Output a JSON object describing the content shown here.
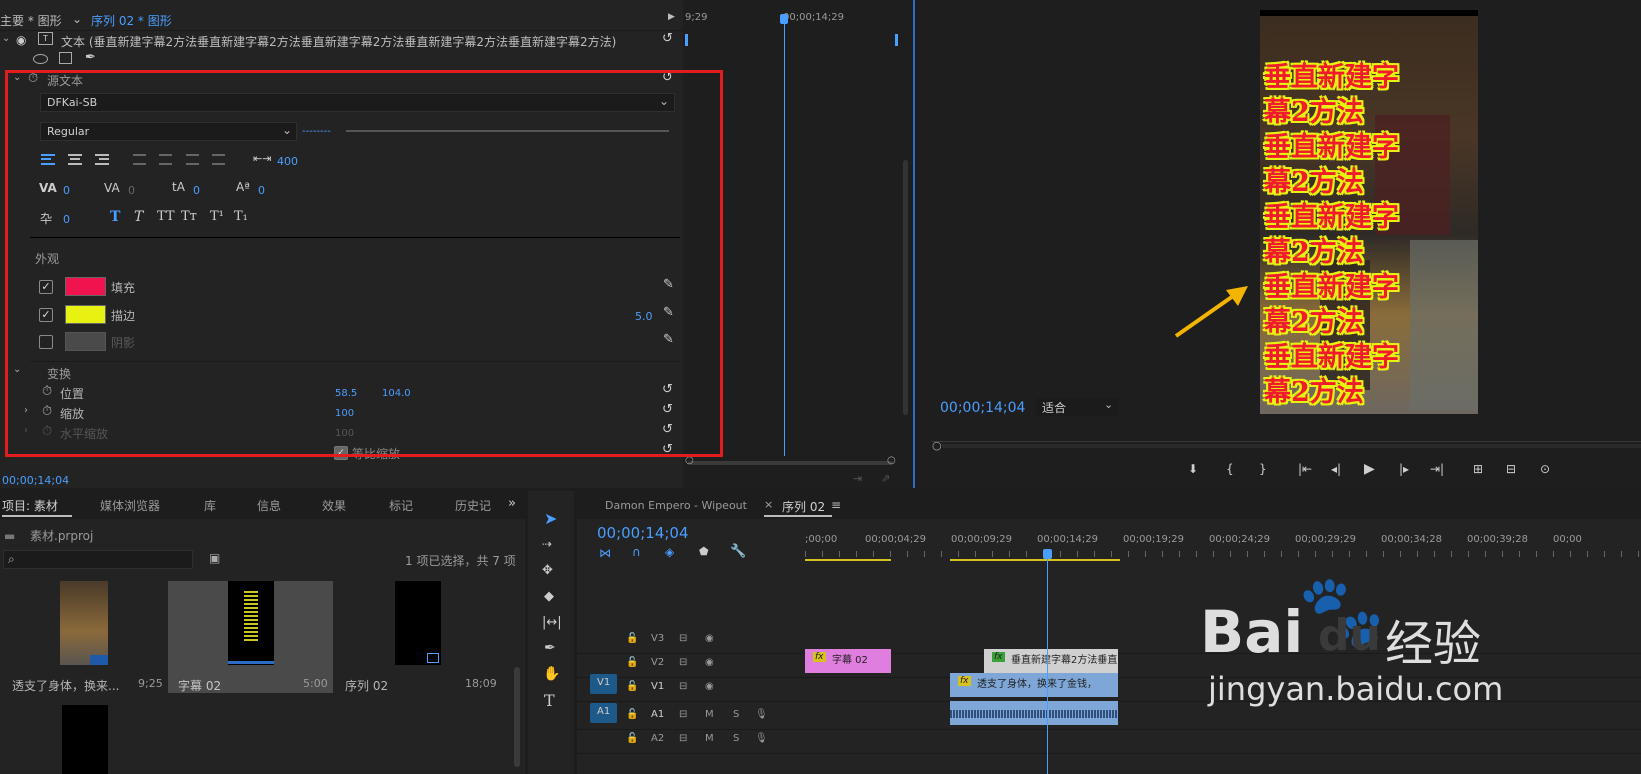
{
  "egp": {
    "tab_main": "主要 * 图形",
    "tab_seq": "序列 02 * 图形",
    "time_left": "9;29",
    "time_playhead": "00;00;14;29",
    "layer_title": "文本 (垂直新建字幕2方法垂直新建字幕2方法垂直新建字幕2方法垂直新建字幕2方法垂直新建字幕2方法)",
    "source_text_label": "源文本",
    "font_name": "DFKai-SB",
    "font_style": "Regular",
    "font_size_dashes": "--------",
    "tab_width": "400",
    "kerning": "0",
    "tracking": "0",
    "leading": "0",
    "baseline": "0",
    "tsume": "0",
    "appearance_label": "外观",
    "fill_label": "填充",
    "fill_color": "#f0134d",
    "stroke_label": "描边",
    "stroke_color": "#e8f212",
    "stroke_width": "5.0",
    "shadow_label": "阴影",
    "transform_label": "变换",
    "position_label": "位置",
    "pos_x": "58.5",
    "pos_y": "104.0",
    "scale_label": "缩放",
    "scale_value": "100",
    "hscale_label": "水平缩放",
    "hscale_value": "100",
    "uniform_label": "等比缩放",
    "bottom_time": "00;00;14;04"
  },
  "program": {
    "caption_lines": [
      "垂直新建字",
      "幕2方法",
      "垂直新建字",
      "幕2方法",
      "垂直新建字",
      "幕2方法",
      "垂直新建字",
      "幕2方法",
      "垂直新建字",
      "幕2方法"
    ],
    "timecode": "00;00;14;04",
    "fit_label": "适合"
  },
  "project": {
    "tabs": [
      "项目: 素材",
      "媒体浏览器",
      "库",
      "信息",
      "效果",
      "标记",
      "历史记"
    ],
    "file": "素材.prproj",
    "selection_info": "1 项已选择，共 7 项",
    "items": [
      {
        "name": "透支了身体，换来...",
        "dur": "9;25"
      },
      {
        "name": "字幕 02",
        "dur": "5:00"
      },
      {
        "name": "序列 02",
        "dur": "18;09"
      }
    ]
  },
  "timeline": {
    "tab_inactive": "Damon Empero - Wipeout",
    "tab_active": "序列 02",
    "timecode": "00;00;14;04",
    "ruler": [
      ";00;00",
      "00;00;04;29",
      "00;00;09;29",
      "00;00;14;29",
      "00;00;19;29",
      "00;00;24;29",
      "00;00;29;29",
      "00;00;34;28",
      "00;00;39;28",
      "00;00"
    ],
    "tracks": [
      "V3",
      "V2",
      "V1",
      "A1",
      "A2"
    ],
    "v1_src": "V1",
    "a1_src": "A1",
    "track_m": "M",
    "track_s": "S",
    "clip_title": "字幕 02",
    "clip_text": "垂直新建字幕2方法垂直",
    "clip_video": "透支了身体，换来了金钱，",
    "fx": "fx"
  },
  "watermark": {
    "brand": "Bai",
    "brand2": "du",
    "cn": "经验",
    "url": "jingyan.baidu.com"
  }
}
